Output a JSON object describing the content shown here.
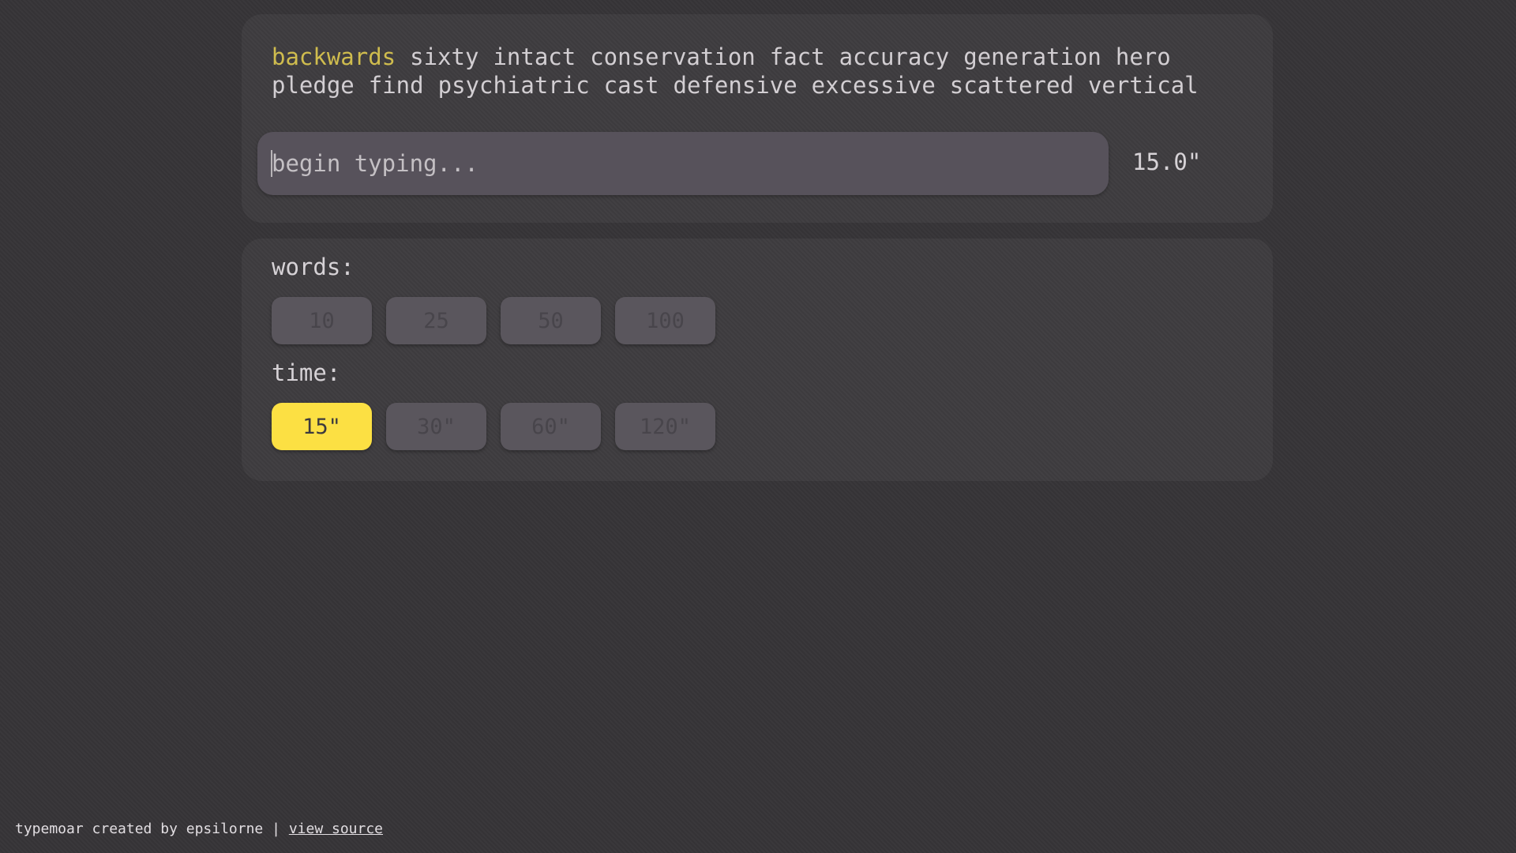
{
  "typing": {
    "words": [
      "backwards",
      "sixty",
      "intact",
      "conservation",
      "fact",
      "accuracy",
      "generation",
      "hero",
      "pledge",
      "find",
      "psychiatric",
      "cast",
      "defensive",
      "excessive",
      "scattered",
      "vertical"
    ],
    "current_index": 0,
    "placeholder": "begin typing...",
    "timer": "15.0\""
  },
  "settings": {
    "words_label": "words:",
    "word_options": [
      "10",
      "25",
      "50",
      "100"
    ],
    "time_label": "time:",
    "time_options": [
      "15\"",
      "30\"",
      "60\"",
      "120\""
    ],
    "time_selected_index": 0
  },
  "footer": {
    "credit": "typemoar created by epsilorne",
    "separator": "|",
    "source_link": "view source"
  },
  "colors": {
    "background": "#363437",
    "accent": "#fce043",
    "current_word": "#cfbc4e"
  }
}
